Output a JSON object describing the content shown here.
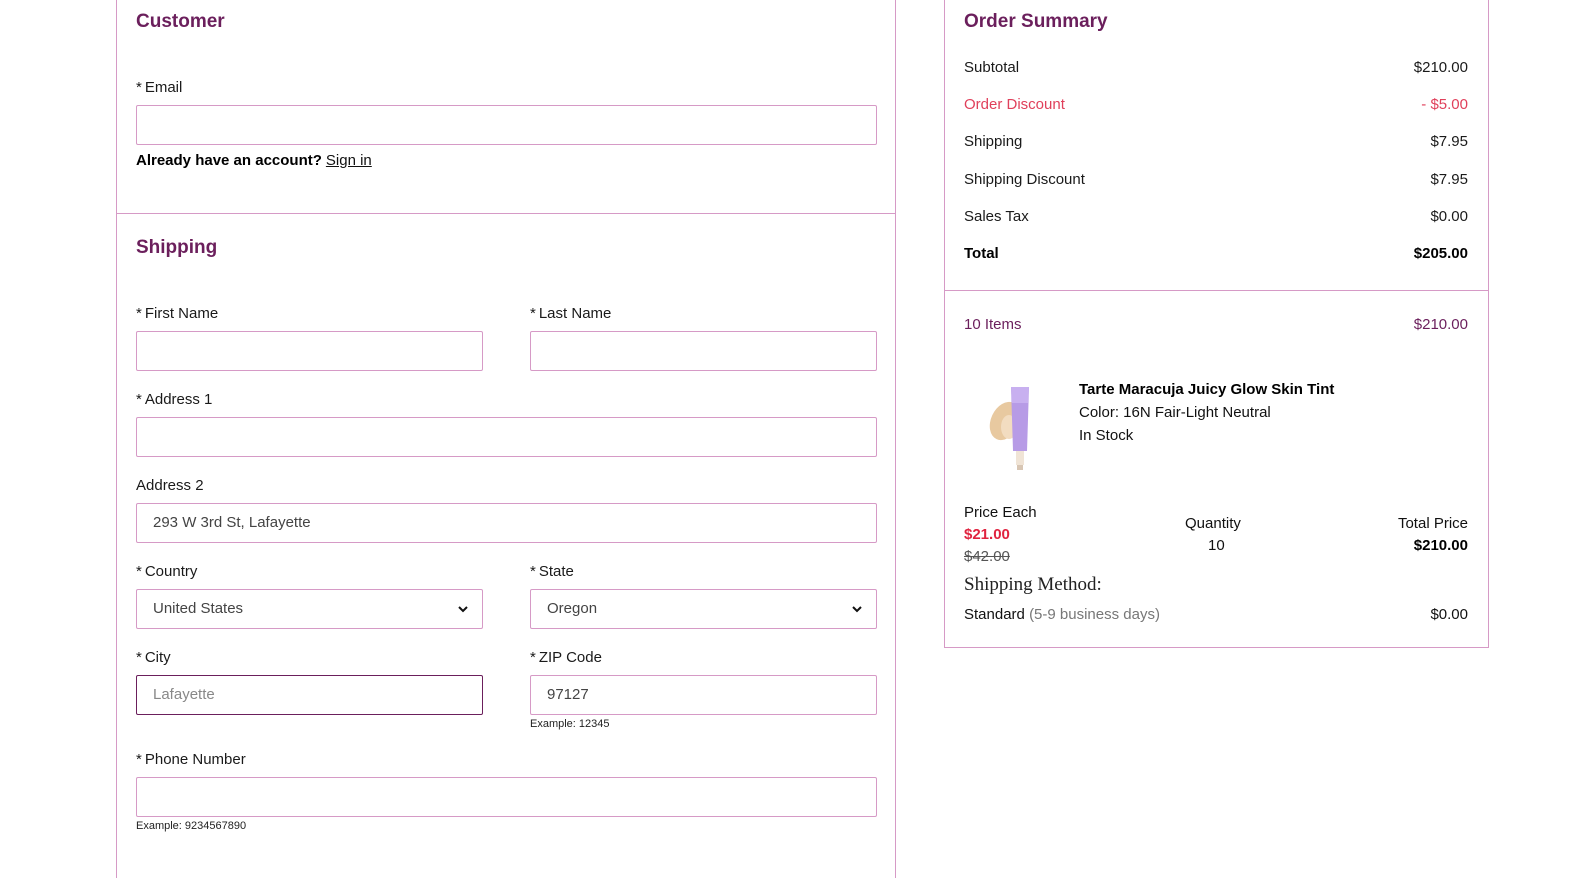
{
  "customer": {
    "title": "Customer",
    "email_label": "Email",
    "required_mark": "*",
    "email_value": "",
    "account_prompt": "Already have an account?",
    "sign_in": "Sign in"
  },
  "shipping": {
    "title": "Shipping",
    "first_name_label": "First Name",
    "last_name_label": "Last Name",
    "address1_label": "Address 1",
    "address2_label": "Address 2",
    "address2_value": "293 W 3rd St, Lafayette",
    "country_label": "Country",
    "country_value": "United States",
    "state_label": "State",
    "state_value": "Oregon",
    "city_label": "City",
    "city_placeholder": "Lafayette",
    "zip_label": "ZIP Code",
    "zip_value": "97127",
    "zip_hint": "Example: 12345",
    "phone_label": "Phone Number",
    "phone_hint": "Example: 9234567890"
  },
  "summary": {
    "title": "Order Summary",
    "subtotal_label": "Subtotal",
    "subtotal_value": "$210.00",
    "order_discount_label": "Order Discount",
    "order_discount_value": "- $5.00",
    "shipping_label": "Shipping",
    "shipping_value": "$7.95",
    "shipping_discount_label": "Shipping Discount",
    "shipping_discount_value": "$7.95",
    "tax_label": "Sales Tax",
    "tax_value": "$0.00",
    "total_label": "Total",
    "total_value": "$205.00",
    "items_count": "10 Items",
    "items_total": "$210.00"
  },
  "product": {
    "name": "Tarte Maracuja Juicy Glow Skin Tint",
    "color": "Color: 16N Fair-Light Neutral",
    "stock": "In Stock",
    "price_each_label": "Price Each",
    "price_sale": "$21.00",
    "price_original": "$42.00",
    "quantity_label": "Quantity",
    "quantity_value": "10",
    "total_price_label": "Total Price",
    "total_price_value": "$210.00"
  },
  "shipping_method": {
    "title": "Shipping Method:",
    "name": "Standard",
    "eta": "(5-9 business days)",
    "price": "$0.00"
  },
  "colors": {
    "brand": "#6b1f5c",
    "border": "#d69ac6",
    "discount": "#e0405b"
  }
}
